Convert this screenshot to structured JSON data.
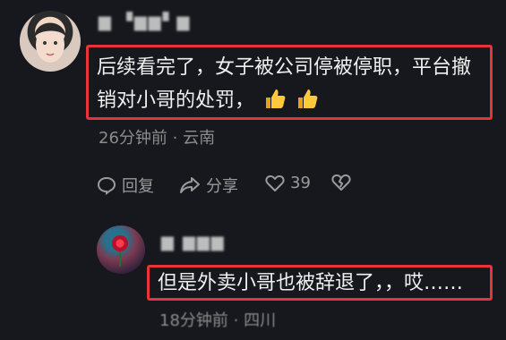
{
  "comments": [
    {
      "username": "▆ ▝▆▆▘▆",
      "text": "后续看完了，女子被公司停被停职，平台撤销对小哥的处罚，",
      "emoji": [
        "thumbs-up",
        "thumbs-up"
      ],
      "meta": "26分钟前 · 云南",
      "actions": {
        "reply": "回复",
        "share": "分享",
        "likes": "39"
      }
    },
    {
      "username": "▆ ▆▆▆",
      "text": "但是外卖小哥也被辞退了，，哎……",
      "meta": "18分钟前 · 四川"
    }
  ],
  "colors": {
    "highlight": "#e7333b",
    "background": "#16181d",
    "muted": "#8c8c8c"
  }
}
